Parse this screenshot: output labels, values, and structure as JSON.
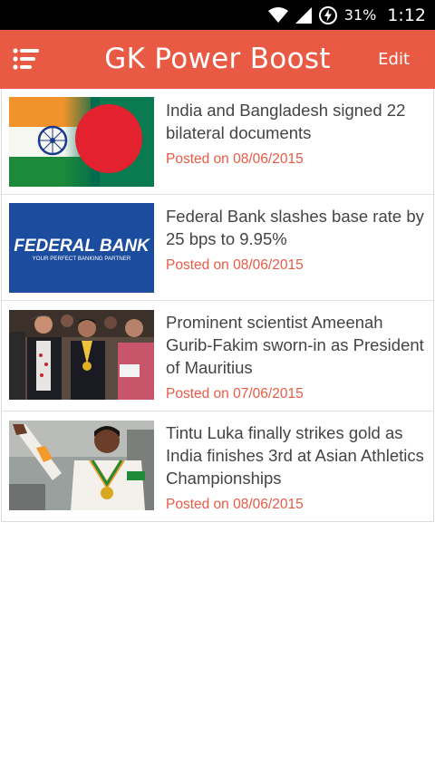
{
  "status_bar": {
    "battery_percent": "31%",
    "time": "1:12"
  },
  "app_bar": {
    "title": "GK Power Boost",
    "edit_label": "Edit",
    "background_color": "#e95a45"
  },
  "news": [
    {
      "headline": "India and Bangladesh signed 22 bilateral documents",
      "posted": "Posted on 08/06/2015",
      "image": "india-bangladesh-flags"
    },
    {
      "headline": "Federal Bank slashes base rate by 25 bps to 9.95%",
      "posted": "Posted on 08/06/2015",
      "image": "federal-bank-logo",
      "image_text": "FEDERAL BANK",
      "image_subtext": "YOUR PERFECT BANKING PARTNER"
    },
    {
      "headline": "Prominent scientist Ameenah Gurib-Fakim sworn-in as President of Mauritius",
      "posted": "Posted on 07/06/2015",
      "image": "sworn-in-ceremony-photo"
    },
    {
      "headline": "Tintu Luka finally strikes gold as India finishes 3rd at Asian Athletics Championships",
      "posted": "Posted on 08/06/2015",
      "image": "athlete-celebrating-photo"
    }
  ]
}
